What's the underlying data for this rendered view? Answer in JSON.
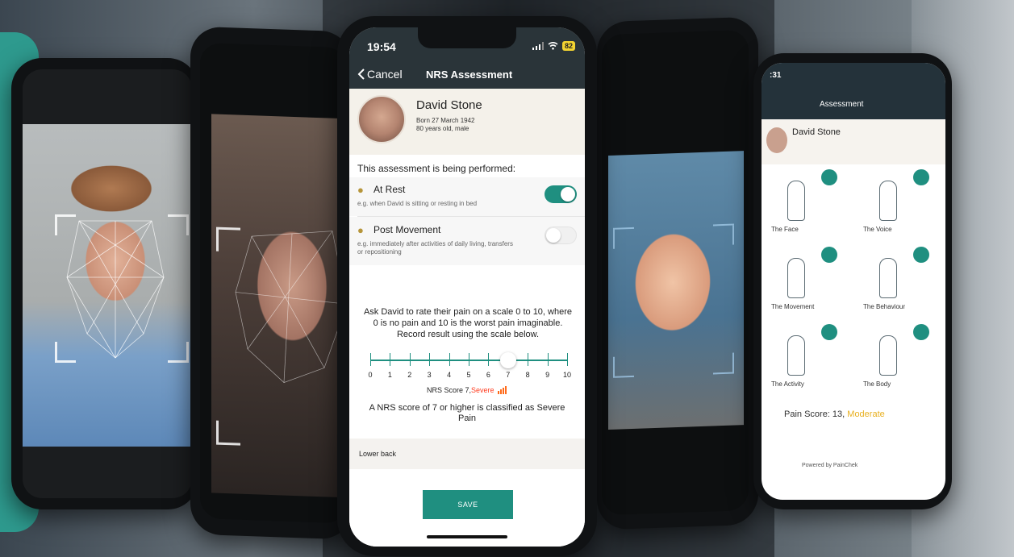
{
  "main_phone": {
    "status_time": "19:54",
    "battery": "82",
    "nav": {
      "cancel_label": "Cancel",
      "title": "NRS Assessment"
    },
    "patient": {
      "name": "David Stone",
      "born": "Born 27 March 1942",
      "age_sex": "80 years old, male"
    },
    "performed_heading": "This assessment is being performed:",
    "options": [
      {
        "title": "At Rest",
        "subtitle": "e.g. when David is sitting or resting in bed",
        "enabled": true,
        "icon": "person-standing-icon"
      },
      {
        "title": "Post Movement",
        "subtitle": "e.g. immediately after activities of daily living, transfers or repositioning",
        "enabled": false,
        "icon": "person-walking-icon"
      }
    ],
    "instructions": "Ask David to rate their pain on a scale 0 to 10, where 0 is no pain and 10 is the worst pain imaginable. Record result using the scale below.",
    "scale": {
      "labels": [
        "0",
        "1",
        "2",
        "3",
        "4",
        "5",
        "6",
        "7",
        "8",
        "9",
        "10"
      ],
      "value": 7
    },
    "nrs_score_label": "NRS Score 7,",
    "severity": "Severe",
    "classification": "A NRS score of 7 or higher is classified as Severe Pain",
    "location": "Lower back",
    "save_label": "SAVE",
    "colors": {
      "accent": "#1f8f80",
      "severe": "#ff3b1e",
      "header": "#2a3439"
    }
  },
  "right_phone": {
    "status_time": ":31",
    "title": "Assessment",
    "patient_name": "David Stone",
    "cells": [
      "The Face",
      "The Voice",
      "The Movement",
      "The Behaviour",
      "The Activity",
      "The Body"
    ],
    "score_label": "Pain Score: 13,",
    "score_severity": "Moderate",
    "footer": "Powered by PainChek"
  }
}
